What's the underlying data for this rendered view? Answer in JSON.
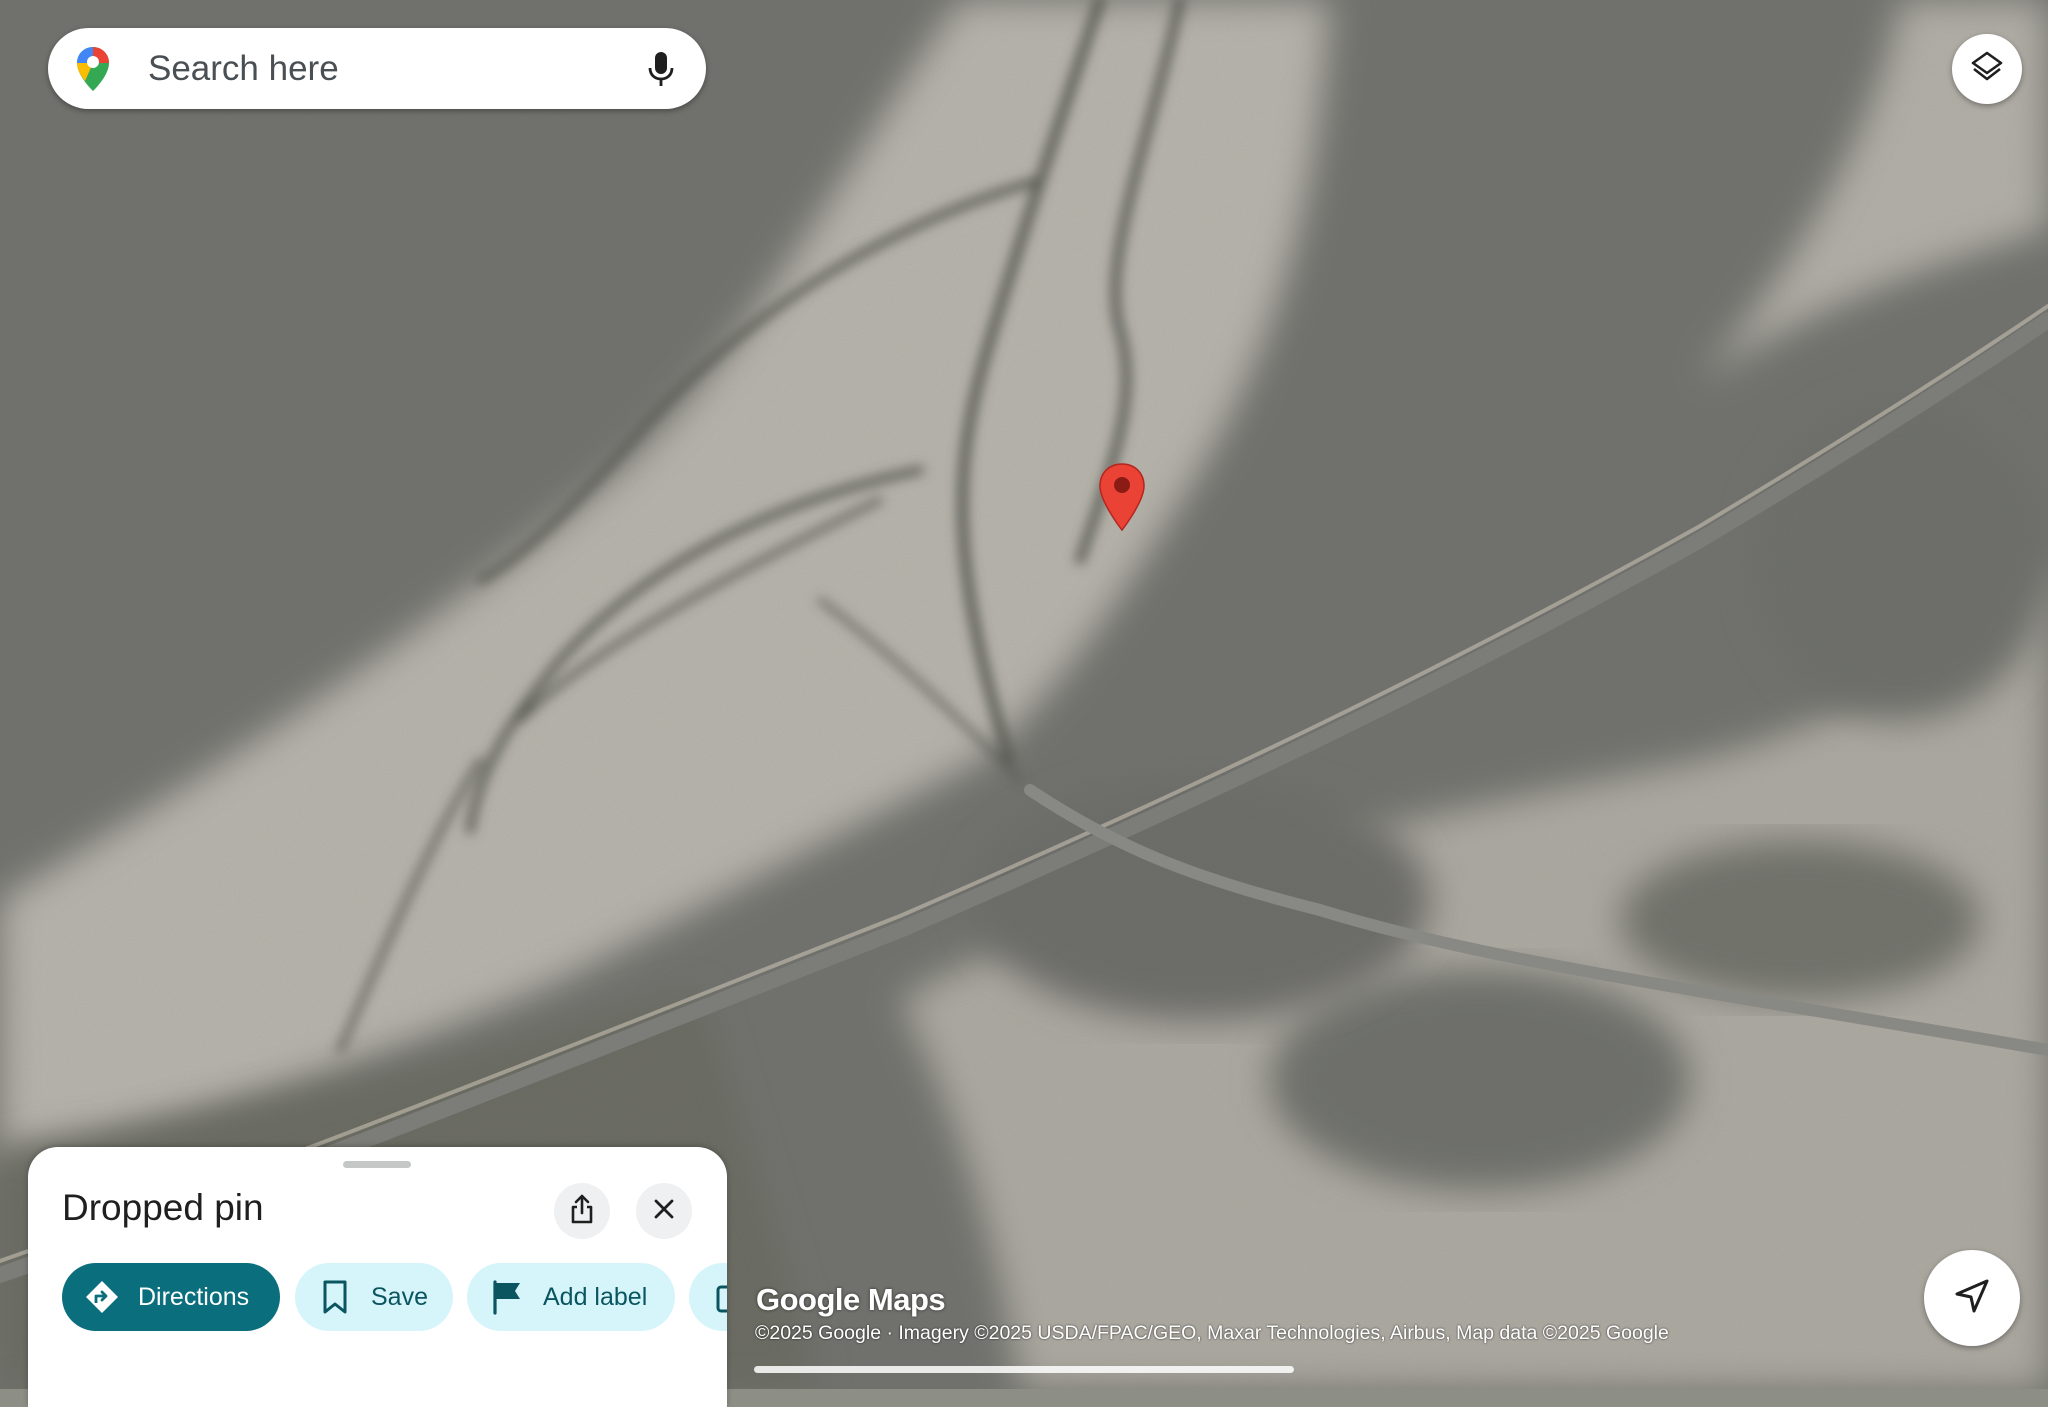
{
  "map": {
    "type": "satellite",
    "marker_color": "#ea4335",
    "watermark": "Google Maps",
    "attribution": "©2025 Google · Imagery ©2025 USDA/FPAC/GEO, Maxar Technologies, Airbus, Map data ©2025 Google"
  },
  "search": {
    "placeholder": "Search here",
    "icon_left": "google-maps-pin-logo",
    "icon_right": "microphone-icon"
  },
  "layers_button": {
    "icon": "layers-icon"
  },
  "locate_button": {
    "icon": "navigation-arrow-icon"
  },
  "sheet": {
    "title": "Dropped pin",
    "share_icon": "share-icon",
    "close_icon": "close-icon",
    "actions": [
      {
        "label": "Directions",
        "icon": "directions-icon"
      },
      {
        "label": "Save",
        "icon": "bookmark-icon"
      },
      {
        "label": "Add label",
        "icon": "flag-icon"
      },
      {
        "label": "",
        "icon": "more-icon"
      }
    ]
  },
  "colors": {
    "primary_button": "#0b6e7d",
    "tonal_button": "#d6f5fb",
    "tonal_text": "#0b5560"
  }
}
